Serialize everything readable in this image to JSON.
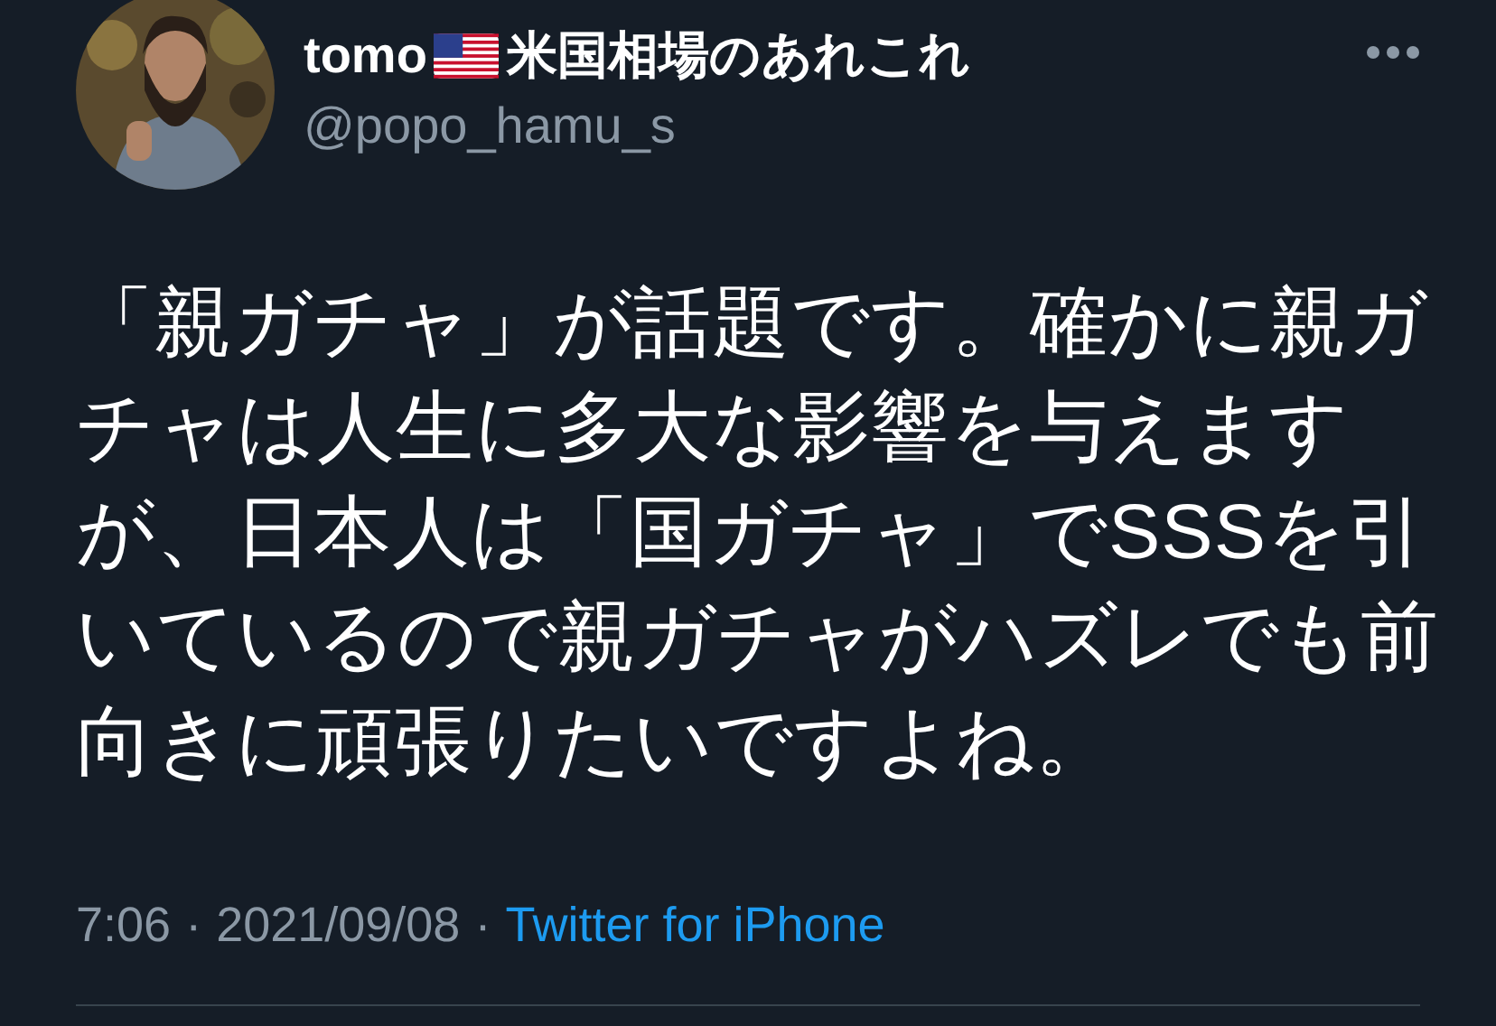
{
  "author": {
    "name": "tomo",
    "name_suffix": "米国相場のあれこれ",
    "handle": "@popo_hamu_s"
  },
  "body": {
    "lines": [
      "「親ガチャ」が話題です。確かに親ガ",
      "チャは人生に多大な影響を与えます",
      "が、日本人は「国ガチャ」でSSSを引",
      "いているので親ガチャがハズレでも前",
      "向きに頑張りたいですよね。"
    ]
  },
  "meta": {
    "time": "7:06",
    "separator": "·",
    "date": "2021/09/08",
    "separator_2": "·",
    "source": "Twitter for iPhone"
  }
}
